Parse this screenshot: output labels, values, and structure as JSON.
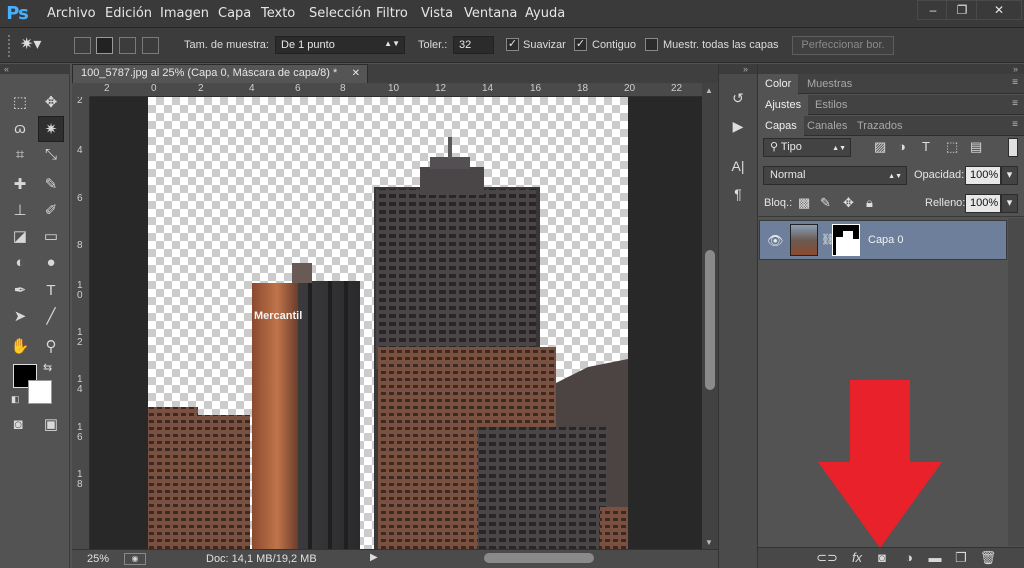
{
  "app": {
    "logo": "Ps"
  },
  "menu": [
    "Archivo",
    "Edición",
    "Imagen",
    "Capa",
    "Texto",
    "Selección",
    "Filtro",
    "Vista",
    "Ventana",
    "Ayuda"
  ],
  "window_controls": {
    "minimize": "–",
    "restore": "❐",
    "close": "✕"
  },
  "options": {
    "sample_size_label": "Tam. de muestra:",
    "sample_size_value": "De 1 punto",
    "tolerance_label": "Toler.:",
    "tolerance_value": "32",
    "antialias_label": "Suavizar",
    "antialias_checked": true,
    "contiguous_label": "Contiguo",
    "contiguous_checked": true,
    "sample_all_label": "Muestr. todas las capas",
    "sample_all_checked": false,
    "refine_edge_label": "Perfeccionar bor."
  },
  "document": {
    "tab_title": "100_5787.jpg al 25% (Capa 0, Máscara de capa/8) *",
    "close_glyph": "✕",
    "ruler_top": [
      "2",
      "0",
      "2",
      "4",
      "6",
      "8",
      "10",
      "12",
      "14",
      "16",
      "18",
      "20",
      "22"
    ],
    "ruler_left": [
      "2",
      "4",
      "6",
      "8",
      "1",
      "0",
      "1",
      "2",
      "1",
      "4",
      "1",
      "6",
      "1",
      "8"
    ]
  },
  "status": {
    "zoom": "25%",
    "doc_info": "Doc: 14,1 MB/19,2 MB"
  },
  "panels": {
    "group1_tabs": [
      "Color",
      "Muestras"
    ],
    "group2_tabs": [
      "Ajustes",
      "Estilos"
    ],
    "group3_tabs": [
      "Capas",
      "Canales",
      "Trazados"
    ],
    "filter_kind": "Tipo",
    "blend_mode": "Normal",
    "opacity_label": "Opacidad:",
    "opacity_value": "100%",
    "lock_label": "Bloq.:",
    "fill_label": "Relleno:",
    "fill_value": "100%",
    "layer_name": "Capa 0"
  },
  "canvas_image": {
    "sign_text": "Mercantil"
  },
  "colors": {
    "accent_ps": "#46b1ff",
    "selected_layer": "#6d7f9a",
    "arrow": "#e8212b"
  }
}
